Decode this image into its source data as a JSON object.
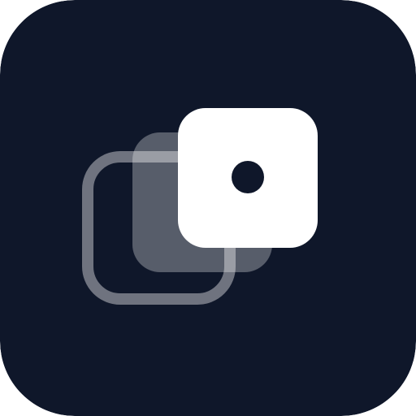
{
  "icon": {
    "name": "layered-squares-with-dot",
    "colors": {
      "background": "#0F172A",
      "foreground": "#FFFFFF",
      "dot": "#0F172A"
    },
    "layer_opacity": {
      "back_outline": 0.4,
      "middle_fill": 0.3,
      "front_fill": 1.0
    }
  }
}
